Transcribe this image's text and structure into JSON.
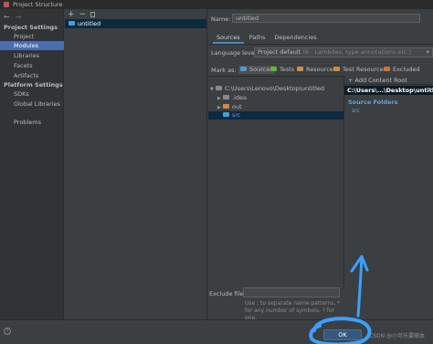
{
  "window": {
    "title": "Project Structure"
  },
  "nav": {
    "back": "←",
    "forward": "→",
    "project_settings_header": "Project Settings",
    "project_items": [
      "Project",
      "Modules",
      "Libraries",
      "Facets",
      "Artifacts"
    ],
    "platform_settings_header": "Platform Settings",
    "platform_items": [
      "SDKs",
      "Global Libraries"
    ],
    "problems": "Problems",
    "selected": "Modules"
  },
  "modules": {
    "add": "+",
    "remove": "−",
    "items": [
      "untitled"
    ]
  },
  "main": {
    "name_label": "Name:",
    "name_value": "untitled",
    "tabs": [
      "Sources",
      "Paths",
      "Dependencies"
    ],
    "active_tab": "Sources",
    "language_level_label": "Language level:",
    "language_level_value": "Project default",
    "language_level_hint": "(8 - Lambdas, type annotations etc.)",
    "mark_as_label": "Mark as:",
    "mark_buttons": [
      "Sources",
      "Tests",
      "Resources",
      "Test Resources",
      "Excluded"
    ],
    "tree": {
      "root": "C:\\Users\\Lenovo\\Desktop\\untitled",
      "children": [
        ".idea",
        "out",
        "src"
      ],
      "selected": "src"
    },
    "right_panel": {
      "add_content_root": "+ Add Content Root",
      "root_path": "C:\\Users\\...\\Desktop\\untitled",
      "source_folders_label": "Source Folders",
      "source_folders": [
        "src"
      ]
    },
    "exclude_files_label": "Exclude files:",
    "exclude_files_value": "",
    "exclude_help": "Use ; to separate name patterns, * for any number of symbols, ? for one."
  },
  "footer": {
    "help": "?",
    "ok_label": "OK",
    "watermark": "CSDN @小可乐要随本"
  },
  "colors": {
    "selection": "#4b6eaf",
    "annotation": "#3aa0ff",
    "primary_button": "#365880"
  }
}
